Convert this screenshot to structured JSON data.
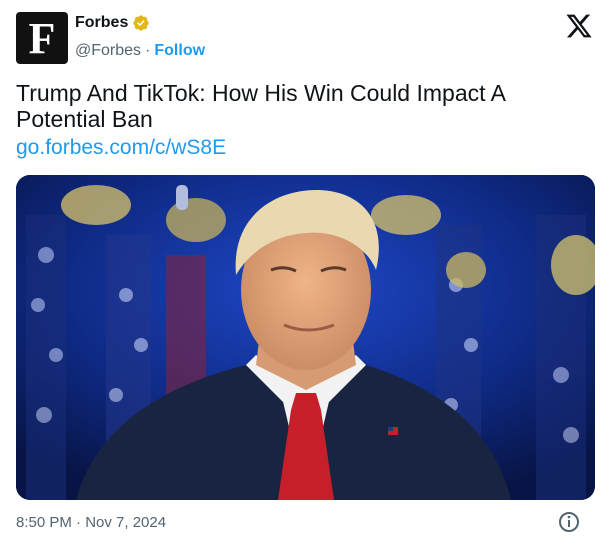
{
  "author": {
    "name": "Forbes",
    "handle": "@Forbes",
    "separator": "·",
    "follow_label": "Follow",
    "avatar_letter": "F"
  },
  "tweet": {
    "text": "Trump And TikTok: How His Win Could Impact A Potential Ban",
    "link": "go.forbes.com/c/wS8E",
    "timestamp": "8:50 PM · Nov 7, 2024"
  },
  "icons": {
    "verified": "verified-badge-icon",
    "x": "x-logo-icon",
    "info": "info-icon"
  },
  "colors": {
    "accent": "#1d9bf0",
    "verified_gold": "#e2b719",
    "text": "#0f1419",
    "muted": "#536471"
  }
}
